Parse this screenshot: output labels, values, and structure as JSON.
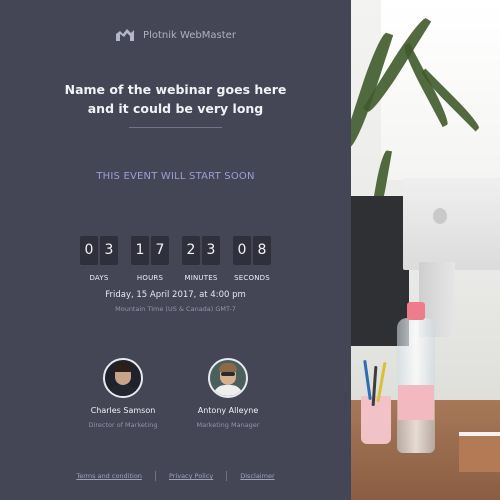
{
  "brand": {
    "name": "Plotnik WebMaster",
    "logo_icon": "brand-logo-icon"
  },
  "webinar": {
    "title_line1": "Name of the webinar goes here",
    "title_line2": "and it could be very long",
    "status": "THIS EVENT WILL START SOON"
  },
  "countdown": {
    "days": {
      "d1": "0",
      "d2": "3",
      "label": "DAYS"
    },
    "hours": {
      "d1": "1",
      "d2": "7",
      "label": "HOURS"
    },
    "minutes": {
      "d1": "2",
      "d2": "3",
      "label": "MINUTES"
    },
    "seconds": {
      "d1": "0",
      "d2": "8",
      "label": "SECONDS"
    }
  },
  "schedule": {
    "date": "Friday, 15 April 2017, at 4:00 pm",
    "timezone": "Mountain Time (US & Canada) GMT-7"
  },
  "speakers": [
    {
      "name": "Charles Samson",
      "role": "Director of Marketing"
    },
    {
      "name": "Antony Alleyne",
      "role": "Marketing Manager"
    }
  ],
  "footer": {
    "terms": "Terms and condition",
    "privacy": "Privacy Policy",
    "disclaimer": "Disclaimer"
  },
  "colors": {
    "panel_bg": "#444655",
    "digit_bg": "#2f303b",
    "accent_text": "#9c9fd2"
  }
}
